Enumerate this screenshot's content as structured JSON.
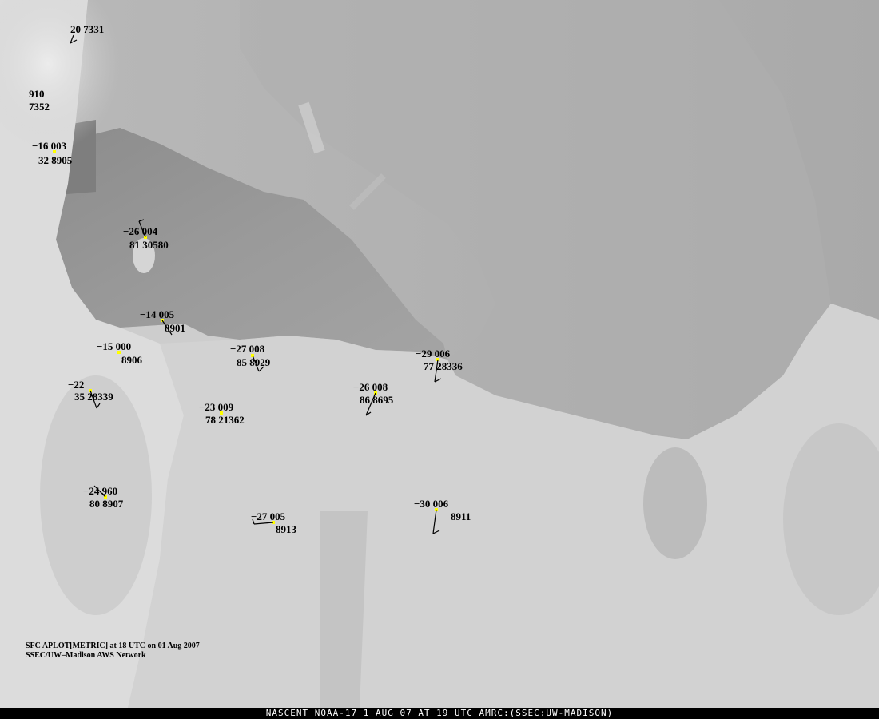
{
  "title": "",
  "caption": {
    "line1": "SFC APLOT[METRIC] at 18 UTC on 01 Aug 2007",
    "line2": "SSEC/UW–Madison AWS Network"
  },
  "footer": "NASCENT NOAA-17 1 AUG 07 AT 19 UTC AMRC:(SSEC:UW-MADISON)",
  "colors": {
    "marker": "#ffff00",
    "text": "#000000",
    "footer_bg": "#000000",
    "footer_text": "#ffffff"
  },
  "stations": [
    {
      "id": "st-top-left",
      "upper": "20 7331",
      "lower": ""
    },
    {
      "id": "st-910",
      "upper": "910",
      "lower": "7352"
    },
    {
      "id": "st-8905",
      "upper": "−16 003",
      "lower": "32 8905"
    },
    {
      "id": "st-30580",
      "upper": "−26 004",
      "lower": "81 30580"
    },
    {
      "id": "st-8901",
      "upper": "−14 005",
      "lower": "8901"
    },
    {
      "id": "st-8906",
      "upper": "−15 000",
      "lower": "8906"
    },
    {
      "id": "st-28339",
      "upper": "−22",
      "lower": "35 28339"
    },
    {
      "id": "st-8929",
      "upper": "−27 008",
      "lower": "85 8929"
    },
    {
      "id": "st-21362",
      "upper": "−23 009",
      "lower": "78 21362"
    },
    {
      "id": "st-28336",
      "upper": "−29 006",
      "lower": "77 28336"
    },
    {
      "id": "st-8695",
      "upper": "−26 008",
      "lower": "86 8695"
    },
    {
      "id": "st-8907",
      "upper": "−24 960",
      "lower": "80 8907"
    },
    {
      "id": "st-8913",
      "upper": "−27 005",
      "lower": "8913"
    },
    {
      "id": "st-8911",
      "upper": "−30 006",
      "lower": "8911"
    }
  ]
}
